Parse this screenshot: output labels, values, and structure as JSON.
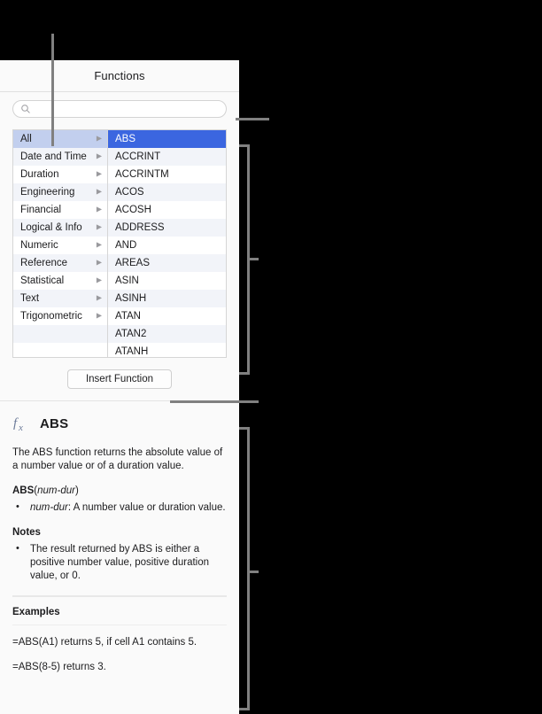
{
  "panel": {
    "title": "Functions"
  },
  "search": {
    "icon": "search-icon",
    "value": "",
    "placeholder": ""
  },
  "categories": {
    "items": [
      {
        "label": "All",
        "selected": true,
        "disclosure": "▶"
      },
      {
        "label": "Date and Time",
        "selected": false,
        "disclosure": "▶"
      },
      {
        "label": "Duration",
        "selected": false,
        "disclosure": "▶"
      },
      {
        "label": "Engineering",
        "selected": false,
        "disclosure": "▶"
      },
      {
        "label": "Financial",
        "selected": false,
        "disclosure": "▶"
      },
      {
        "label": "Logical & Info",
        "selected": false,
        "disclosure": "▶"
      },
      {
        "label": "Numeric",
        "selected": false,
        "disclosure": "▶"
      },
      {
        "label": "Reference",
        "selected": false,
        "disclosure": "▶"
      },
      {
        "label": "Statistical",
        "selected": false,
        "disclosure": "▶"
      },
      {
        "label": "Text",
        "selected": false,
        "disclosure": "▶"
      },
      {
        "label": "Trigonometric",
        "selected": false,
        "disclosure": "▶"
      },
      {
        "label": "",
        "selected": false,
        "disclosure": ""
      },
      {
        "label": "",
        "selected": false,
        "disclosure": ""
      }
    ]
  },
  "functions": {
    "items": [
      {
        "label": "ABS",
        "selected": true
      },
      {
        "label": "ACCRINT",
        "selected": false
      },
      {
        "label": "ACCRINTM",
        "selected": false
      },
      {
        "label": "ACOS",
        "selected": false
      },
      {
        "label": "ACOSH",
        "selected": false
      },
      {
        "label": "ADDRESS",
        "selected": false
      },
      {
        "label": "AND",
        "selected": false
      },
      {
        "label": "AREAS",
        "selected": false
      },
      {
        "label": "ASIN",
        "selected": false
      },
      {
        "label": "ASINH",
        "selected": false
      },
      {
        "label": "ATAN",
        "selected": false
      },
      {
        "label": "ATAN2",
        "selected": false
      },
      {
        "label": "ATANH",
        "selected": false
      }
    ]
  },
  "insert_button": {
    "label": "Insert Function"
  },
  "help": {
    "icon": "fx-icon",
    "function_name": "ABS",
    "description": "The ABS function returns the absolute value of a number value or of a duration value.",
    "syntax": {
      "name": "ABS",
      "open": "(",
      "argument": "num-dur",
      "close": ")"
    },
    "parameters": [
      {
        "arg": "num-dur",
        "text": ": A number value or duration value."
      }
    ],
    "notes_heading": "Notes",
    "notes": [
      {
        "text": "The result returned by ABS is either a positive number value, positive duration value, or 0."
      }
    ],
    "examples_heading": "Examples",
    "examples": [
      "=ABS(A1) returns 5, if cell A1 contains 5.",
      "=ABS(8-5) returns 3."
    ]
  },
  "colors": {
    "selection_blue": "#3b66e0",
    "category_selection": "#c2cfee",
    "zebra": "#f2f4f9",
    "callout": "#808080",
    "panel_background": "#fafafa",
    "fx_icon": "#6b7a99"
  }
}
